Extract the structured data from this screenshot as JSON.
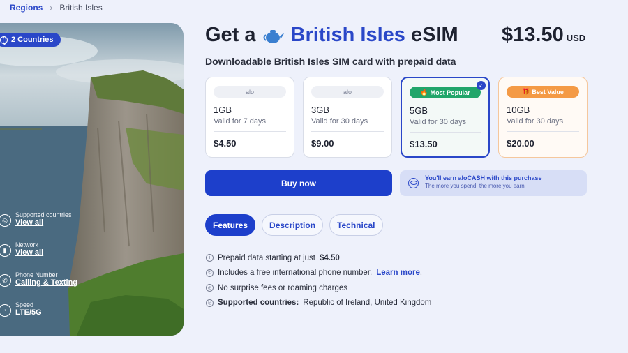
{
  "breadcrumb": {
    "root": "Regions",
    "separator": "›",
    "current": "British Isles"
  },
  "hero": {
    "countries_badge": "2 Countries",
    "info": [
      {
        "caption": "Supported countries",
        "value": "View all"
      },
      {
        "caption": "Network",
        "value": "View all"
      },
      {
        "caption": "Phone Number",
        "value": "Calling & Texting"
      },
      {
        "caption": "Speed",
        "value": "LTE/5G"
      }
    ]
  },
  "product": {
    "title_prefix": "Get a",
    "title_highlight": "British Isles",
    "title_suffix": "eSIM",
    "price": "$13.50",
    "currency": "USD",
    "subtitle": "Downloadable British Isles SIM card with prepaid data"
  },
  "plans": [
    {
      "badge": "alo",
      "size": "1GB",
      "validity": "Valid for 7 days",
      "price": "$4.50"
    },
    {
      "badge": "alo",
      "size": "3GB",
      "validity": "Valid for 30 days",
      "price": "$9.00"
    },
    {
      "badge": "Most Popular",
      "size": "5GB",
      "validity": "Valid for 30 days",
      "price": "$13.50",
      "selected": true
    },
    {
      "badge": "Best Value",
      "size": "10GB",
      "validity": "Valid for 30 days",
      "price": "$20.00"
    }
  ],
  "actions": {
    "buy_label": "Buy now",
    "earn_title": "You'll earn aloCASH with this purchase",
    "earn_subtitle": "The more you spend, the more you earn"
  },
  "tabs": [
    "Features",
    "Description",
    "Technical"
  ],
  "features": {
    "prepaid_text": "Prepaid data starting at just",
    "prepaid_value": "$4.50",
    "phone_text": "Includes a free international phone number.",
    "phone_link": "Learn more",
    "phone_end": ".",
    "fees_text": "No surprise fees or roaming charges",
    "countries_label": "Supported countries:",
    "countries_value": "Republic of Ireland, United Kingdom"
  },
  "colors": {
    "accent": "#1d3fcb",
    "popular": "#21a66a",
    "best_value": "#f49a45",
    "background": "#eef1fb"
  }
}
